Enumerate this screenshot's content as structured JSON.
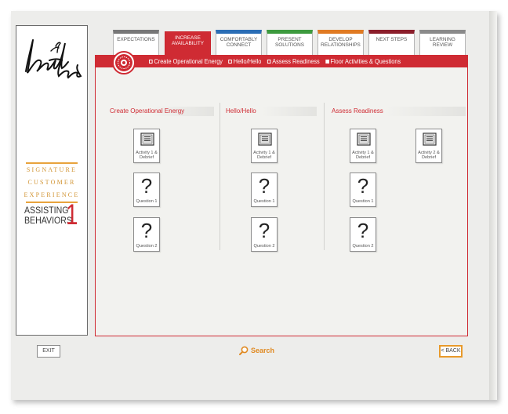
{
  "brand": {
    "rule_color": "#e8a33d",
    "sce_lines": [
      "SIGNATURE",
      "CUSTOMER",
      "EXPERIENCE"
    ],
    "module_lines": [
      "ASSISTING",
      "BEHAVIORS"
    ],
    "module_number": "1"
  },
  "tabs": [
    {
      "label": "EXPECTATIONS",
      "color": "#6b6b6b",
      "active": false
    },
    {
      "label": "INCREASE AVAILABILITY",
      "color": "#cf2b33",
      "active": true
    },
    {
      "label": "COMFORTABLY CONNECT",
      "color": "#2a6db5",
      "active": false
    },
    {
      "label": "PRESENT SOLUTIONS",
      "color": "#3d9a3e",
      "active": false
    },
    {
      "label": "DEVELOP RELATIONSHIPS",
      "color": "#e07a22",
      "active": false
    },
    {
      "label": "NEXT STEPS",
      "color": "#8b1e2b",
      "active": false
    },
    {
      "label": "LEARNING REVIEW",
      "color": "#8a8a8a",
      "active": false
    }
  ],
  "subnav": [
    {
      "label": "Create Operational Energy",
      "filled": false
    },
    {
      "label": "Hello/Hello",
      "filled": false
    },
    {
      "label": "Assess Readiness",
      "filled": false
    },
    {
      "label": "Floor Activities & Questions",
      "filled": true
    }
  ],
  "sections": [
    {
      "title": "Create  Operational  Energy"
    },
    {
      "title": "Hello/Hello"
    },
    {
      "title": "Assess Readiness"
    }
  ],
  "cards": {
    "activity_1": "Activity 1 & Debrief",
    "activity_2": "Activity 2 & Debrief",
    "question_1": "Question 1",
    "question_2": "Question 2",
    "q_glyph": "?"
  },
  "footer": {
    "exit_label": "EXIT",
    "search_label": "Search",
    "back_label": "< BACK"
  },
  "accent": "#cf2b33"
}
